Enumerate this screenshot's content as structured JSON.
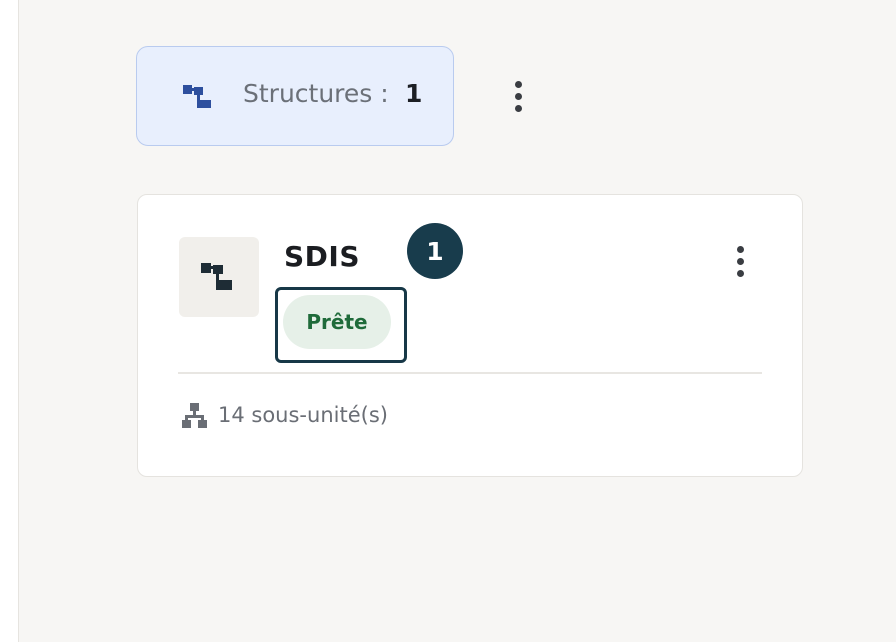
{
  "summary": {
    "label": "Structures :",
    "count": "1",
    "icon": "structure-icon",
    "accent": "#2d4f9e"
  },
  "card": {
    "title": "SDIS",
    "badge": "1",
    "status": "Prête",
    "status_color": "#1f6b3a",
    "subunits": "14 sous-unité(s)",
    "icon": "structure-icon",
    "sub_icon": "hierarchy-icon"
  }
}
